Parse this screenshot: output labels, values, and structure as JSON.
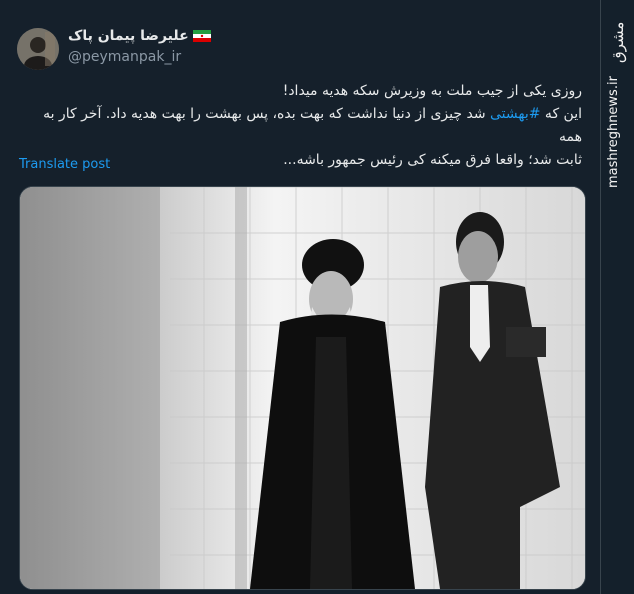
{
  "author": {
    "name": "علیرضا پیمان پاک",
    "handle": "@peymanpak_ir",
    "flag_icon": "iran-flag-icon"
  },
  "tweet": {
    "line1": "روزی یکی از جیب ملت به وزیرش سکه هدیه میداد!",
    "line2_pre": "این که ",
    "hashtag": "#بهشتی",
    "line2_post": " شد چیزی از دنیا نداشت که بهت بده، پس بهشت را بهت هدیه داد. آخر کار به همه",
    "line3": "ثابت شد؛ واقعا فرق میکنه کی رئیس جمهور باشه..."
  },
  "translate_label": "Translate post",
  "watermark": {
    "logo": "مشرق",
    "url": "mashreghnews.ir"
  },
  "colors": {
    "background": "#15202b",
    "link": "#1d9bf0",
    "text": "#e7e9ea",
    "muted": "#8b98a5"
  }
}
